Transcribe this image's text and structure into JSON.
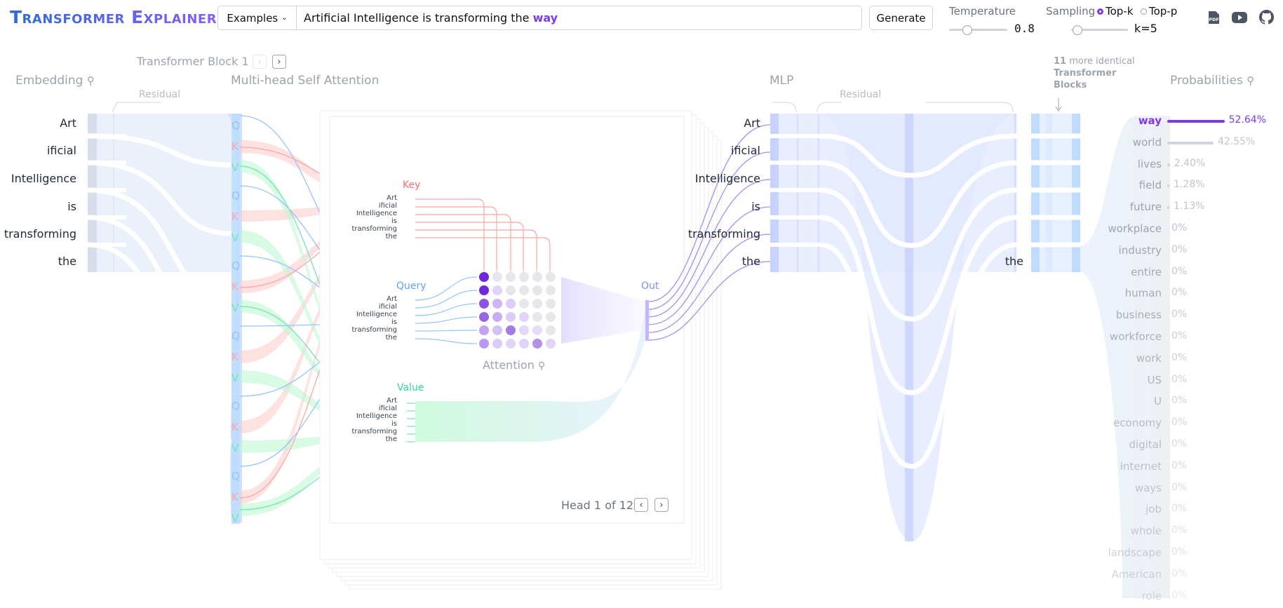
{
  "app": {
    "title": "Transformer Explainer"
  },
  "input": {
    "examples_label": "Examples",
    "prompt_text": "Artificial Intelligence is transforming the",
    "prompt_prediction": "way"
  },
  "generate_label": "Generate",
  "temperature": {
    "label": "Temperature",
    "value": "0.8",
    "level": 0.3
  },
  "sampling": {
    "label": "Sampling",
    "option_topk": "Top-k",
    "option_topp": "Top-p",
    "selected": "Top-k",
    "value": "k=5",
    "level": 0.1
  },
  "header_icons": [
    "pdf-icon",
    "youtube-icon",
    "github-icon"
  ],
  "sections": {
    "block_title": "Transformer Block 1",
    "embedding": "Embedding",
    "attention": "Multi-head Self Attention",
    "mlp": "MLP",
    "probabilities": "Probabilities",
    "residual": "Residual",
    "more_blocks_count": "11",
    "more_blocks_text": "more identical",
    "more_blocks_bold": "Transformer Blocks",
    "key": "Key",
    "query": "Query",
    "value": "Value",
    "out": "Out",
    "attention_map": "Attention",
    "head_counter": "Head 1 of 12"
  },
  "tokens": [
    "Art",
    "ificial",
    "Intelligence",
    "is",
    "transforming",
    "the"
  ],
  "last_token": "the",
  "qkv": [
    "Q",
    "K",
    "V"
  ],
  "probabilities": [
    {
      "word": "way",
      "pct": "52.64%",
      "p": 0.5264
    },
    {
      "word": "world",
      "pct": "42.55%",
      "p": 0.4255
    },
    {
      "word": "lives",
      "pct": "2.40%",
      "p": 0.024
    },
    {
      "word": "field",
      "pct": "1.28%",
      "p": 0.0128
    },
    {
      "word": "future",
      "pct": "1.13%",
      "p": 0.0113
    },
    {
      "word": "workplace",
      "pct": "0%",
      "p": 0
    },
    {
      "word": "industry",
      "pct": "0%",
      "p": 0
    },
    {
      "word": "entire",
      "pct": "0%",
      "p": 0
    },
    {
      "word": "human",
      "pct": "0%",
      "p": 0
    },
    {
      "word": "business",
      "pct": "0%",
      "p": 0
    },
    {
      "word": "workforce",
      "pct": "0%",
      "p": 0
    },
    {
      "word": "work",
      "pct": "0%",
      "p": 0
    },
    {
      "word": "US",
      "pct": "0%",
      "p": 0
    },
    {
      "word": "U",
      "pct": "0%",
      "p": 0
    },
    {
      "word": "economy",
      "pct": "0%",
      "p": 0
    },
    {
      "word": "digital",
      "pct": "0%",
      "p": 0
    },
    {
      "word": "Internet",
      "pct": "0%",
      "p": 0
    },
    {
      "word": "ways",
      "pct": "0%",
      "p": 0
    },
    {
      "word": "job",
      "pct": "0%",
      "p": 0
    },
    {
      "word": "whole",
      "pct": "0%",
      "p": 0
    },
    {
      "word": "landscape",
      "pct": "0%",
      "p": 0
    },
    {
      "word": "American",
      "pct": "0%",
      "p": 0
    },
    {
      "word": "role",
      "pct": "0%",
      "p": 0
    }
  ],
  "colors": {
    "accent": "#7c3aed",
    "query": "#93c5fd",
    "key": "#fca5a5",
    "value": "#6ee7b7",
    "mlp": "#c7d2fe"
  }
}
